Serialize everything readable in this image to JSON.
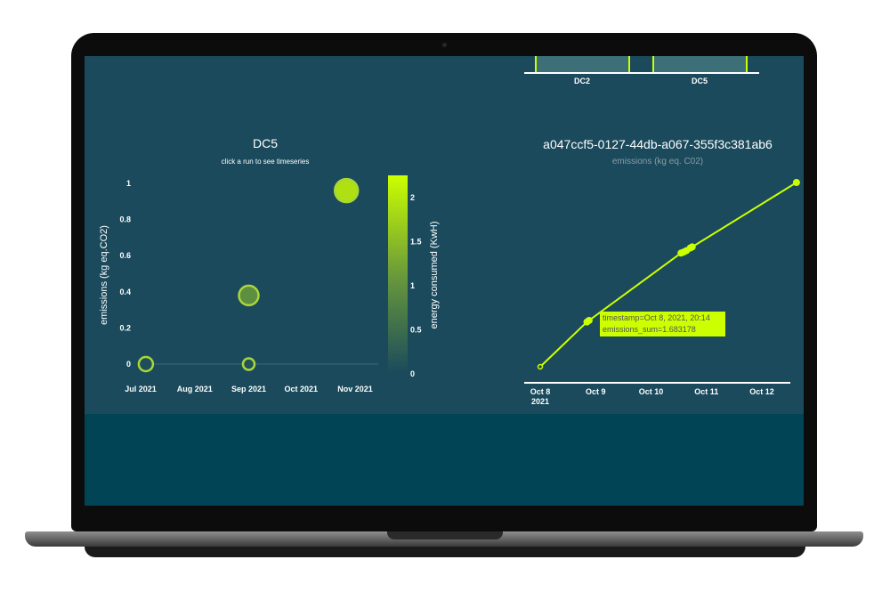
{
  "bars": {
    "categories": [
      "DC2",
      "DC5"
    ]
  },
  "scatter": {
    "title": "DC5",
    "subtitle": "click a run to see timeseries",
    "ylabel": "emissions (kg eq.CO2)",
    "colorbar_label": "energy consumed (KwH)"
  },
  "line": {
    "title": "a047ccf5-0127-44db-a067-355f3c381ab6",
    "subtitle": "emissions (kg eq. C02)",
    "tooltip_line1": "timestamp=Oct 8, 2021, 20:14",
    "tooltip_line2": "emissions_sum=1.683178"
  },
  "colors": {
    "accent": "#ccff00",
    "panel": "#1a4a5c",
    "background": "#004455"
  },
  "chart_data": [
    {
      "type": "bar",
      "categories": [
        "DC2",
        "DC5"
      ]
    },
    {
      "type": "scatter",
      "title": "DC5",
      "subtitle": "click a run to see timeseries",
      "ylabel": "emissions (kg eq.CO2)",
      "x_ticks": [
        "Jul 2021",
        "Aug 2021",
        "Sep 2021",
        "Oct 2021",
        "Nov 2021"
      ],
      "y_ticks": [
        "0",
        "0.2",
        "0.4",
        "0.6",
        "0.8",
        "1"
      ],
      "ylim": [
        0,
        1
      ],
      "colorbar": {
        "label": "energy consumed (KwH)",
        "ticks": [
          "0",
          "0.5",
          "1",
          "1.5",
          "2"
        ],
        "range": [
          0,
          2.25
        ]
      },
      "points": [
        {
          "x": "2021-07-04",
          "y": 0.0,
          "energy": 0.05,
          "size": 16
        },
        {
          "x": "2021-09-01",
          "y": 0.0,
          "energy": 0.1,
          "size": 13
        },
        {
          "x": "2021-09-01",
          "y": 0.38,
          "energy": 0.95,
          "size": 22
        },
        {
          "x": "2021-10-27",
          "y": 0.96,
          "energy": 1.9,
          "size": 26
        }
      ]
    },
    {
      "type": "line",
      "title": "a047ccf5-0127-44db-a067-355f3c381ab6",
      "subtitle": "emissions (kg eq. C02)",
      "x_ticks": [
        "Oct 8\n2021",
        "Oct 9",
        "Oct 10",
        "Oct 11",
        "Oct 12"
      ],
      "points": [
        {
          "x": "2021-10-08 00:00",
          "y": 0.0
        },
        {
          "x": "2021-10-08 20:14",
          "y": 1.683178
        },
        {
          "x": "2021-10-08 21:10",
          "y": 1.74
        },
        {
          "x": "2021-10-10 13:00",
          "y": 4.27
        },
        {
          "x": "2021-10-10 14:10",
          "y": 4.31
        },
        {
          "x": "2021-10-10 15:20",
          "y": 4.36
        },
        {
          "x": "2021-10-10 17:00",
          "y": 4.46
        },
        {
          "x": "2021-10-10 17:50",
          "y": 4.5
        },
        {
          "x": "2021-10-12 15:00",
          "y": 6.92
        }
      ],
      "tooltip": [
        "timestamp=Oct 8, 2021, 20:14",
        "emissions_sum=1.683178"
      ]
    }
  ]
}
